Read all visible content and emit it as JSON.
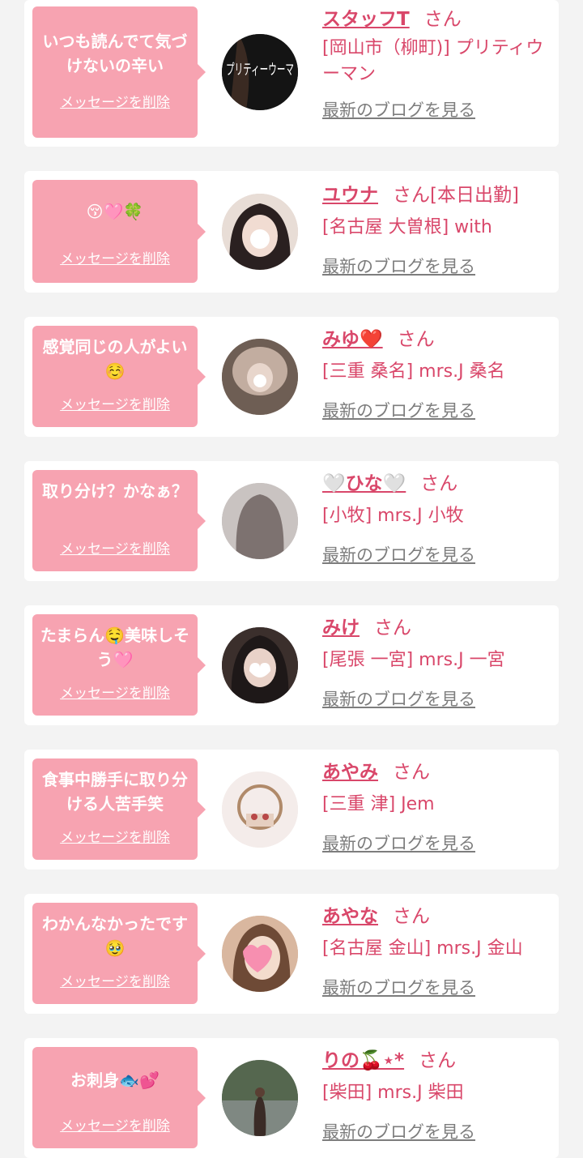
{
  "colors": {
    "accent": "#d9476a",
    "bubble": "#f7a3b1",
    "background": "#f3f3f3",
    "card": "#ffffff",
    "blog_link": "#7d7d7d"
  },
  "entries": [
    {
      "message": "いつも読んでて気づけないの辛い",
      "delete_label": "メッセージを削除",
      "name": "スタッフT",
      "honorific": "さん",
      "shop": "[岡山市（柳町)] プリティウーマン",
      "blog_label": "最新のブログを見る",
      "avatar_text": "プリティーウーマ"
    },
    {
      "message": "😚🩷🍀",
      "delete_label": "メッセージを削除",
      "name": "ユウナ",
      "honorific": "さん[本日出勤]",
      "shop": "[名古屋 大曽根] with",
      "blog_label": "最新のブログを見る"
    },
    {
      "message": "感覚同じの人がよい☺️",
      "delete_label": "メッセージを削除",
      "name": "みゆ❤️",
      "honorific": "さん",
      "shop": "[三重 桑名] mrs.J 桑名",
      "blog_label": "最新のブログを見る"
    },
    {
      "message": "取り分け？かなぁ？",
      "delete_label": "メッセージを削除",
      "name": "🤍ひな🤍",
      "honorific": "さん",
      "shop": "[小牧] mrs.J 小牧",
      "blog_label": "最新のブログを見る"
    },
    {
      "message": "たまらん🤤美味しそう🩷",
      "delete_label": "メッセージを削除",
      "name": "みけ",
      "honorific": "さん",
      "shop": "[尾張 一宮] mrs.J 一宮",
      "blog_label": "最新のブログを見る"
    },
    {
      "message": "食事中勝手に取り分ける人苦手笑",
      "delete_label": "メッセージを削除",
      "name": "あやみ",
      "honorific": "さん",
      "shop": "[三重 津] Jem",
      "blog_label": "最新のブログを見る"
    },
    {
      "message": "わかんなかったです🥹",
      "delete_label": "メッセージを削除",
      "name": "あやな",
      "honorific": "さん",
      "shop": "[名古屋 金山] mrs.J 金山",
      "blog_label": "最新のブログを見る"
    },
    {
      "message": "お刺身🐟💕",
      "delete_label": "メッセージを削除",
      "name": "りの🍒⋆*",
      "honorific": "さん",
      "shop": "[柴田] mrs.J 柴田",
      "blog_label": "最新のブログを見る"
    }
  ]
}
